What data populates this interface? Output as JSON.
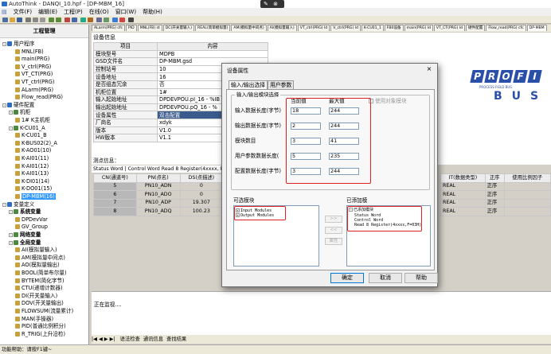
{
  "window": {
    "title": "AutoThink - DANQI_10.hpf - [DP-MBM_16]"
  },
  "title_tools": {
    "tool1": "✎",
    "tool2": "⊗"
  },
  "menu": {
    "items": [
      "文件(F)",
      "编辑(E)",
      "工程(P)",
      "在线(O)",
      "窗口(W)",
      "帮助(H)"
    ]
  },
  "tabs": [
    "ALarm(PRG) cfc",
    "PID",
    "MNL(FB) st",
    "DC(开关量输入)",
    "REAL(简单模拟量)",
    "AM(模拟量中间点)",
    "AI(模拟量输入)",
    "VT_ctrl(PRG) ld",
    "V_ctrl(PRG) ld",
    "K-CU01_1",
    "FB0设备",
    "main(PRG) ld",
    "VT_CT(PRG) ld",
    "硬件配置",
    "Flow_read(PRG) cfc",
    "DP-MBM"
  ],
  "left_panel": {
    "header": "工程管理",
    "items": [
      {
        "label": "用户程序",
        "level": 0
      },
      {
        "label": "MNL(FB)",
        "level": 2
      },
      {
        "label": "main(PRG)",
        "level": 2
      },
      {
        "label": "V_ctrl(PRG)",
        "level": 2
      },
      {
        "label": "VT_CT(PRG)",
        "level": 2
      },
      {
        "label": "VT_ctrl(PRG)",
        "level": 2
      },
      {
        "label": "ALarm(PRG)",
        "level": 2
      },
      {
        "label": "Flow_read(PRG)",
        "level": 2
      },
      {
        "label": "硬件配置",
        "level": 0
      },
      {
        "label": "机柜",
        "level": 1
      },
      {
        "label": "1# K主机柜",
        "level": 2
      },
      {
        "label": "K-CU01_A",
        "level": 1
      },
      {
        "label": "K-CU01_B",
        "level": 2
      },
      {
        "label": "K-BUS02(2)_A",
        "level": 2
      },
      {
        "label": "K-AO01(10)",
        "level": 2
      },
      {
        "label": "K-AI01(11)",
        "level": 2
      },
      {
        "label": "K-AI01(12)",
        "level": 2
      },
      {
        "label": "K-AI01(13)",
        "level": 2
      },
      {
        "label": "K-DI01(14)",
        "level": 2
      },
      {
        "label": "K-DO01(15)",
        "level": 2
      },
      {
        "label": "DP-MBM(16)",
        "level": 2,
        "selected": true
      },
      {
        "label": "变量定义",
        "level": 0
      },
      {
        "label": "系统变量",
        "level": 1,
        "bold": true
      },
      {
        "label": "DPDevVar",
        "level": 2
      },
      {
        "label": "GV_Group",
        "level": 2
      },
      {
        "label": "网络变量",
        "level": 1,
        "bold": true
      },
      {
        "label": "全局变量",
        "level": 1,
        "bold": true
      },
      {
        "label": "AI(模拟量输入)",
        "level": 2
      },
      {
        "label": "AM(模拟量中间点)",
        "level": 2
      },
      {
        "label": "AO(模拟量输出)",
        "level": 2
      },
      {
        "label": "BOOL(简单布尔量)",
        "level": 2
      },
      {
        "label": "BYTEM(简化字节)",
        "level": 2
      },
      {
        "label": "CTU(递增计数器)",
        "level": 2
      },
      {
        "label": "DI(开关量输入)",
        "level": 2
      },
      {
        "label": "DOV(开关量输出)",
        "level": 2
      },
      {
        "label": "FLOWSUM(流量累计)",
        "level": 2
      },
      {
        "label": "MAN(手操器)",
        "level": 2
      },
      {
        "label": "PID(普通比例积分)",
        "level": 2
      },
      {
        "label": "R_TRIG(上升沿检)",
        "level": 2
      }
    ]
  },
  "device_props": {
    "caption": "设备信息",
    "header_key": "项目",
    "header_value": "内容",
    "rows": [
      {
        "key": "模块型号",
        "value": "MDPB"
      },
      {
        "key": "GSD文件名",
        "value": "DP-MBM.gsd"
      },
      {
        "key": "控制站号",
        "value": "10"
      },
      {
        "key": "设备地址",
        "value": "16"
      },
      {
        "key": "是否组态冗余",
        "value": "否"
      },
      {
        "key": "机柜位置",
        "value": "1#"
      },
      {
        "key": "输入起始地址",
        "value": "DPDEVPOU.pI_16 - %IB"
      },
      {
        "key": "输出起始地址",
        "value": "DPDEVPOU.pQ_16 - %"
      },
      {
        "key": "设备属性",
        "value": "双击配置",
        "highlight": true
      },
      {
        "key": "厂商名",
        "value": "xdyk"
      },
      {
        "key": "版本",
        "value": "V1.0"
      },
      {
        "key": "HW版本",
        "value": "V1.1"
      }
    ]
  },
  "measure_label": "测点信息：",
  "register_label": "Status Word | Control Word   Read 8 Register(4xxxx, F=03)",
  "register_table": {
    "headers": [
      "CN(通道号)",
      "PN(点名)",
      "DS(点描述)"
    ],
    "rows": [
      {
        "cn": "5",
        "pn": "PN10_ADN",
        "ds": "0"
      },
      {
        "cn": "6",
        "pn": "PN10_ADO",
        "ds": "0"
      },
      {
        "cn": "7",
        "pn": "PN10_ADP",
        "ds": "19.307"
      },
      {
        "cn": "8",
        "pn": "PN10_ADQ",
        "ds": "100.23"
      }
    ]
  },
  "register_right": {
    "headers": [
      "IT(数据类型)",
      "正序",
      "使用比例因子"
    ],
    "rows": [
      [
        "REAL",
        "正序",
        ""
      ],
      [
        "REAL",
        "正序",
        ""
      ],
      [
        "REAL",
        "正序",
        ""
      ],
      [
        "REAL",
        "正序",
        ""
      ]
    ]
  },
  "logo": {
    "letters": [
      "P",
      "R",
      "O",
      "F",
      "I"
    ],
    "bus": "BUS",
    "subtitle": "PROCESS FIELD BUS"
  },
  "output": {
    "text": "正在监视...."
  },
  "bottom_tabs": {
    "nav": "|◀ ◀ ▶ ▶|",
    "items": [
      "语法检查",
      "通讯信息",
      "查找结果"
    ]
  },
  "statusbar": {
    "text": "功能帮助：请按F1键~"
  },
  "dialog": {
    "title": "设备属性",
    "close": "×",
    "tabs": [
      "输入/输出选择",
      "用户参数"
    ],
    "io_legend": "输入/输出模块选择",
    "col_current": "当前值",
    "col_max": "最大值",
    "use_modular": "使用对象模块",
    "params": [
      {
        "label": "输入数据长度(字节)",
        "current": "18",
        "max": "244"
      },
      {
        "label": "输出数据长度(字节)",
        "current": "2",
        "max": "244"
      },
      {
        "label": "模块数目",
        "current": "3",
        "max": "41"
      },
      {
        "label": "用户参数数据长度(",
        "current": "5",
        "max": "235"
      },
      {
        "label": "配置数据长度(字节)",
        "current": "3",
        "max": "244"
      }
    ],
    "available_label": "可选模块",
    "available_items": [
      "Input Modules",
      "Output Modules"
    ],
    "added_label": "已添加模",
    "added_root": "已添加模块",
    "added_items": [
      "Status Word",
      "Control Word",
      "Read 8 Register(4xxxx,F=03H)"
    ],
    "btn_add": ">>",
    "btn_remove": "<<",
    "btn_props": "属性",
    "ok": "确定",
    "cancel": "取消",
    "help": "帮助"
  }
}
